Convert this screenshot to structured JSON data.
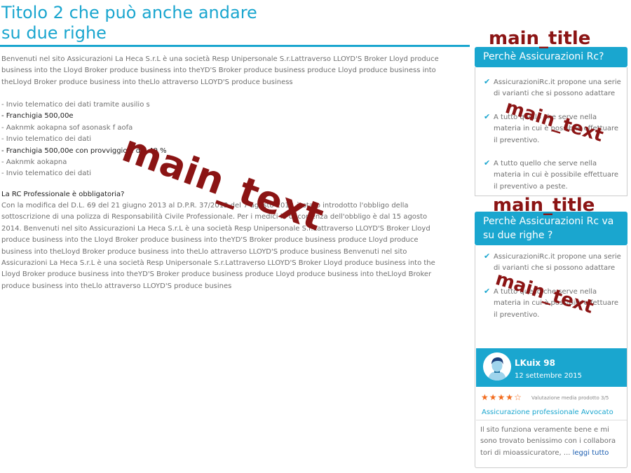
{
  "main": {
    "title": "Titolo 2 che può anche andare su due righe",
    "intro": "Benvenuti nel sito Assicurazioni La Heca S.r.L è una società Resp Unipersonale S.r.Lattraverso LLOYD'S Broker Lloyd produce business into the Lloyd Broker produce business into theYD'S Broker produce business produce Lloyd produce business into theLloyd Broker produce business into theLlo attraverso LLOYD'S produce business",
    "features": [
      "- Invio telematico dei dati tramite ausilio s",
      "- Franchigia 500,00e",
      "- Aaknmk aokapna sof asonask f aofa",
      "- Invio telematico dei dati",
      "- Franchigia 500,00e con provviggioni del 40 %",
      "- Aaknmk aokapna",
      "- Invio telematico dei dati"
    ],
    "rc_question": "La RC Professionale è obbligatoria?",
    "rc_body": "Con la modifica del D.L. 69 del 21 giugno 2013 al D.P.R. 37/2012 del 7 agosto 2012 è stato introdotto l'obbligo della sottoscrizione di una polizza di Responsabilità Civile Professionale. Per i medici la decorrenza dell'obbligo è dal 15 agosto 2014. Benvenuti nel sito Assicurazioni La Heca S.r.L è una società Resp Unipersonale S.r.Lattraverso LLOYD'S Broker Lloyd produce business into the Lloyd Broker produce business into theYD'S Broker produce business produce Lloyd produce business into theLloyd Broker produce business into theLlo attraverso LLOYD'S produce business Benvenuti nel sito Assicurazioni La Heca S.r.L è una società Resp Unipersonale S.r.Lattraverso LLOYD'S Broker Lloyd produce business into the Lloyd Broker produce business into theYD'S Broker produce business produce Lloyd produce business into theLloyd Broker produce business into theLlo attraverso LLOYD'S produce busines",
    "overlay_label": "main_text"
  },
  "sidebar": {
    "box1": {
      "overlay_title": "main_title",
      "overlay_text": "main_text",
      "header": "Perchè Assicurazioni Rc?",
      "items": [
        "AssicurazioniRc.it propone una serie di varianti che si possono adattare",
        "A tutto quello che serve nella materia in cui è possibile effettuare il preventivo.",
        "A tutto quello che serve nella materia in cui è possibile effettuare il preventivo a peste."
      ]
    },
    "box2": {
      "overlay_title": "main_title",
      "overlay_text": "main_text",
      "header": "Perchè Assicurazioni Rc va su due righe ?",
      "items": [
        "AssicurazioniRc.it propone una serie di varianti che si possono adattare",
        "A tutto quello che serve nella materia in cui è possibile effettuare il preventivo."
      ]
    },
    "review": {
      "name": "LKuix 98",
      "date": "12 settembre 2015",
      "rating": 4,
      "rating_max": 5,
      "rating_text": "Valutazione media prodotto 3/5",
      "product": "Assicurazione professionale Avvocato",
      "text": "Il sito funziona veramente bene e mi sono trovato benissimo con i collabora tori di mioassicuratore, ...",
      "read_all": "leggi tutto"
    }
  },
  "colors": {
    "accent": "#1aa6cf",
    "overlay": "#8b1414",
    "star": "#f26b1d",
    "link": "#1a5db0"
  },
  "icons": {
    "check": "check-icon",
    "star": "star-icon",
    "avatar": "user-avatar-icon"
  }
}
